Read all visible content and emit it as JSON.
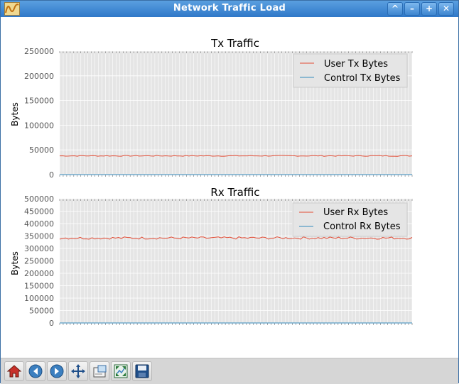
{
  "window": {
    "title": "Network Traffic Load"
  },
  "window_buttons": {
    "shade": "^",
    "minimize": "–",
    "maximize": "+",
    "close": "✕"
  },
  "toolbar": {
    "buttons": [
      {
        "name": "home",
        "icon": "home-icon"
      },
      {
        "name": "back",
        "icon": "arrow-left-icon"
      },
      {
        "name": "forward",
        "icon": "arrow-right-icon"
      },
      {
        "name": "pan",
        "icon": "move-icon"
      },
      {
        "name": "subplots",
        "icon": "configure-subplots-icon"
      },
      {
        "name": "zoom",
        "icon": "zoom-rect-icon"
      },
      {
        "name": "save",
        "icon": "save-icon"
      }
    ]
  },
  "colors": {
    "user": "#e24a33",
    "control": "#348abd",
    "axes_bg": "#e5e5e5"
  },
  "chart_data": [
    {
      "type": "line",
      "title": "Tx Traffic",
      "ylabel": "Bytes",
      "ylim": [
        0,
        250000
      ],
      "yticks": [
        "0",
        "50000",
        "100000",
        "150000",
        "200000",
        "250000"
      ],
      "grid": true,
      "legend_position": "top-right",
      "series": [
        {
          "name": "User Tx Bytes",
          "approx_level": 38000,
          "noise": 900
        },
        {
          "name": "Control Tx Bytes",
          "approx_level": 0,
          "noise": 0
        }
      ]
    },
    {
      "type": "line",
      "title": "Rx Traffic",
      "ylabel": "Bytes",
      "ylim": [
        0,
        500000
      ],
      "yticks": [
        "0",
        "50000",
        "100000",
        "150000",
        "200000",
        "250000",
        "300000",
        "350000",
        "400000",
        "450000",
        "500000"
      ],
      "grid": true,
      "legend_position": "top-right",
      "series": [
        {
          "name": "User Rx Bytes",
          "approx_level": 342000,
          "noise": 5000
        },
        {
          "name": "Control Rx Bytes",
          "approx_level": 0,
          "noise": 0
        }
      ]
    }
  ]
}
